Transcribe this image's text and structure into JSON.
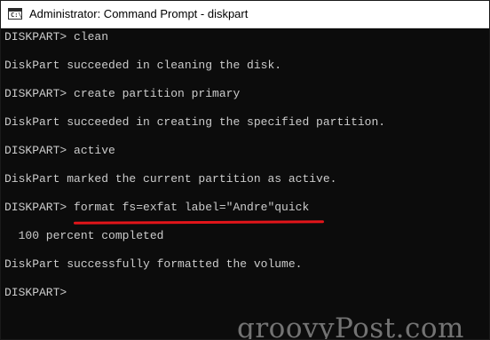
{
  "window": {
    "title": "Administrator: Command Prompt - diskpart",
    "icon": "cmd-icon",
    "icon_glyph": "C:\\"
  },
  "console": {
    "lines": [
      "DISKPART> clean",
      "",
      "DiskPart succeeded in cleaning the disk.",
      "",
      "DISKPART> create partition primary",
      "",
      "DiskPart succeeded in creating the specified partition.",
      "",
      "DISKPART> active",
      "",
      "DiskPart marked the current partition as active.",
      "",
      "DISKPART> format fs=exfat label=\"Andre\"quick",
      "",
      "  100 percent completed",
      "",
      "DiskPart successfully formatted the volume.",
      "",
      "DISKPART>"
    ]
  },
  "annotation": {
    "color": "#e3151a"
  },
  "watermark": {
    "text": "groovyPost.com"
  },
  "colors": {
    "console_bg": "#0c0c0c",
    "console_text": "#cccccc"
  }
}
